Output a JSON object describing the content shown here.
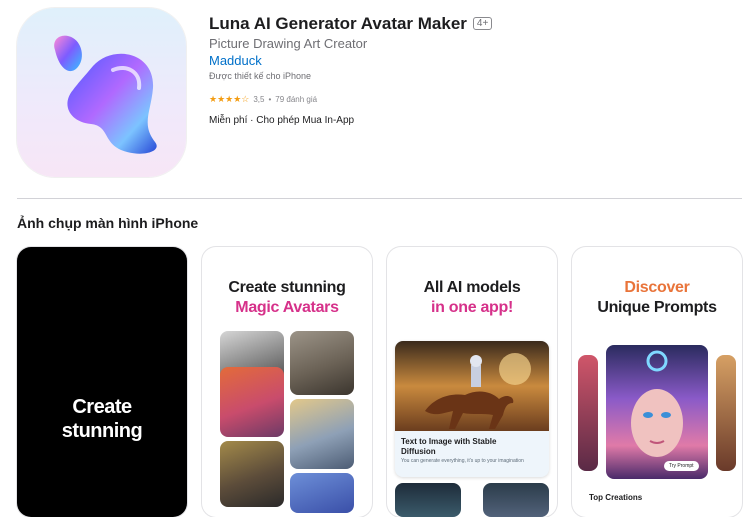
{
  "app": {
    "title": "Luna AI Generator Avatar Maker",
    "age_rating": "4+",
    "subtitle": "Picture Drawing Art Creator",
    "developer": "Madduck",
    "designed_for": "Được thiết kế cho iPhone",
    "rating_value": "3,5",
    "rating_separator": "•",
    "rating_count": "79 đánh giá",
    "rating_stars": 3.5,
    "price": "Miễn phí · Cho phép Mua In-App"
  },
  "screenshots": {
    "section_title": "Ảnh chụp màn hình iPhone",
    "shot1": {
      "line1": "Create",
      "line2": "stunning"
    },
    "shot2": {
      "line1": "Create stunning",
      "line2": "Magic Avatars"
    },
    "shot3": {
      "line1": "All AI models",
      "line2": "in one app!",
      "card_title": "Text to Image with Stable Diffusion",
      "card_desc": "You can generate everything, it's up to your imagination"
    },
    "shot4": {
      "line1": "Discover",
      "line2": "Unique Prompts",
      "try_label": "Try Prompt",
      "footer": "Top Creations"
    }
  },
  "colors": {
    "link": "#0070c9",
    "star": "#f39c12",
    "accent_pink": "#d6318a",
    "accent_orange": "#e9743a"
  }
}
